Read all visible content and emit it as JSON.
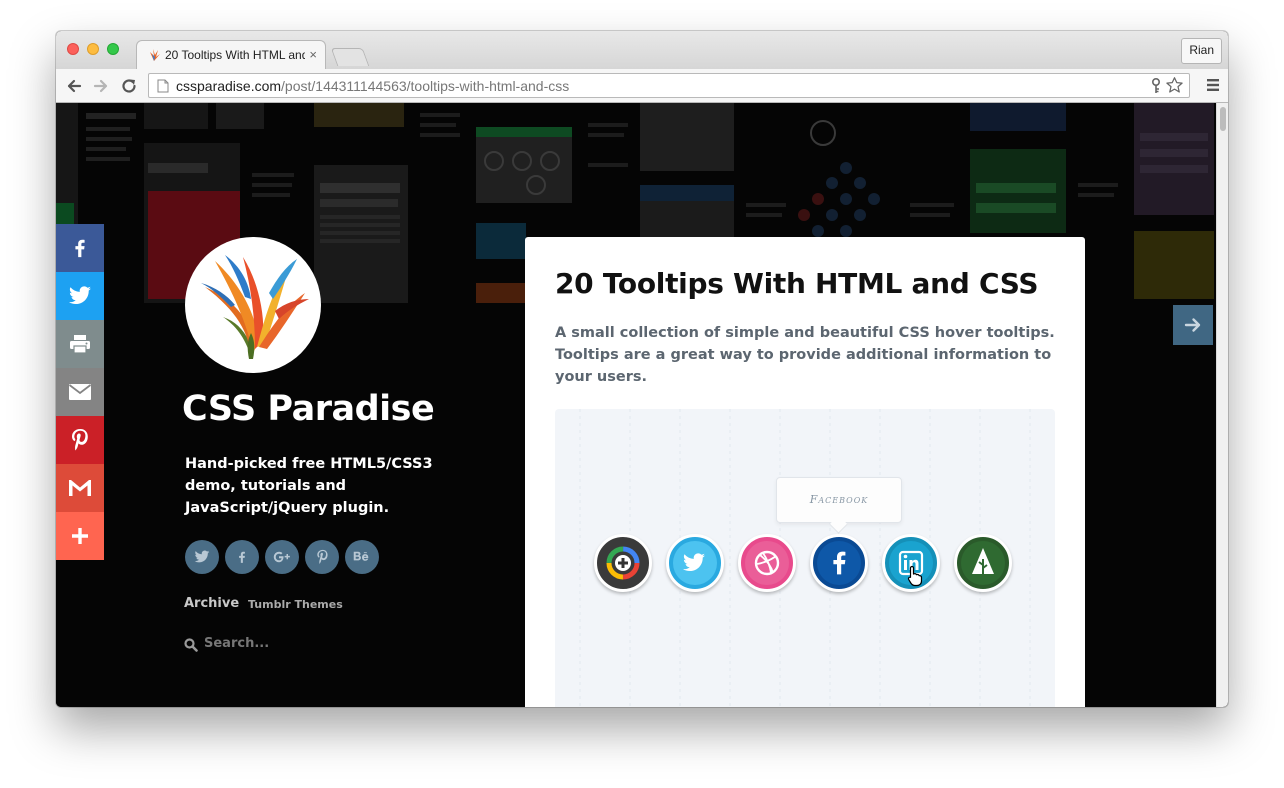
{
  "browser": {
    "tab_title": "20 Tooltips With HTML and CSS",
    "tab_close": "×",
    "profile_name": "Rian",
    "url_host": "cssparadise.com",
    "url_path": "/post/144311144563/tooltips-with-html-and-css"
  },
  "share_bar": [
    {
      "name": "facebook",
      "color": "#3b5998",
      "icon": "facebook-icon"
    },
    {
      "name": "twitter",
      "color": "#1da1f2",
      "icon": "twitter-icon"
    },
    {
      "name": "print",
      "color": "#7f8c8d",
      "icon": "print-icon"
    },
    {
      "name": "email",
      "color": "#848484",
      "icon": "email-icon"
    },
    {
      "name": "pinterest",
      "color": "#cb2027",
      "icon": "pinterest-icon"
    },
    {
      "name": "gmail",
      "color": "#dd4b39",
      "icon": "gmail-icon"
    },
    {
      "name": "more",
      "color": "#ff6550",
      "icon": "plus-icon"
    }
  ],
  "blog": {
    "title": "CSS Paradise",
    "tagline": "Hand-picked free HTML5/CSS3 demo, tutorials and JavaScript/jQuery plugin.",
    "social_links": [
      "twitter-icon",
      "facebook-icon",
      "google-plus-icon",
      "pinterest-icon",
      "behance-icon"
    ],
    "nav_archive": "Archive",
    "nav_themes": "Tumblr Themes",
    "search_placeholder": "Search..."
  },
  "post": {
    "title": "20 Tooltips With HTML and CSS",
    "description": "A small collection of simple and beautiful CSS hover tooltips. Tooltips are a great way to provide additional information to your users.",
    "demo_tooltip": "Facebook",
    "demo_icons": [
      "google-plus-icon",
      "twitter-icon",
      "dribbble-icon",
      "facebook-icon",
      "linkedin-icon",
      "forrst-icon"
    ]
  },
  "colors": {
    "accent": "#406783",
    "page_bg": "#050505",
    "card_bg": "#ffffff"
  }
}
